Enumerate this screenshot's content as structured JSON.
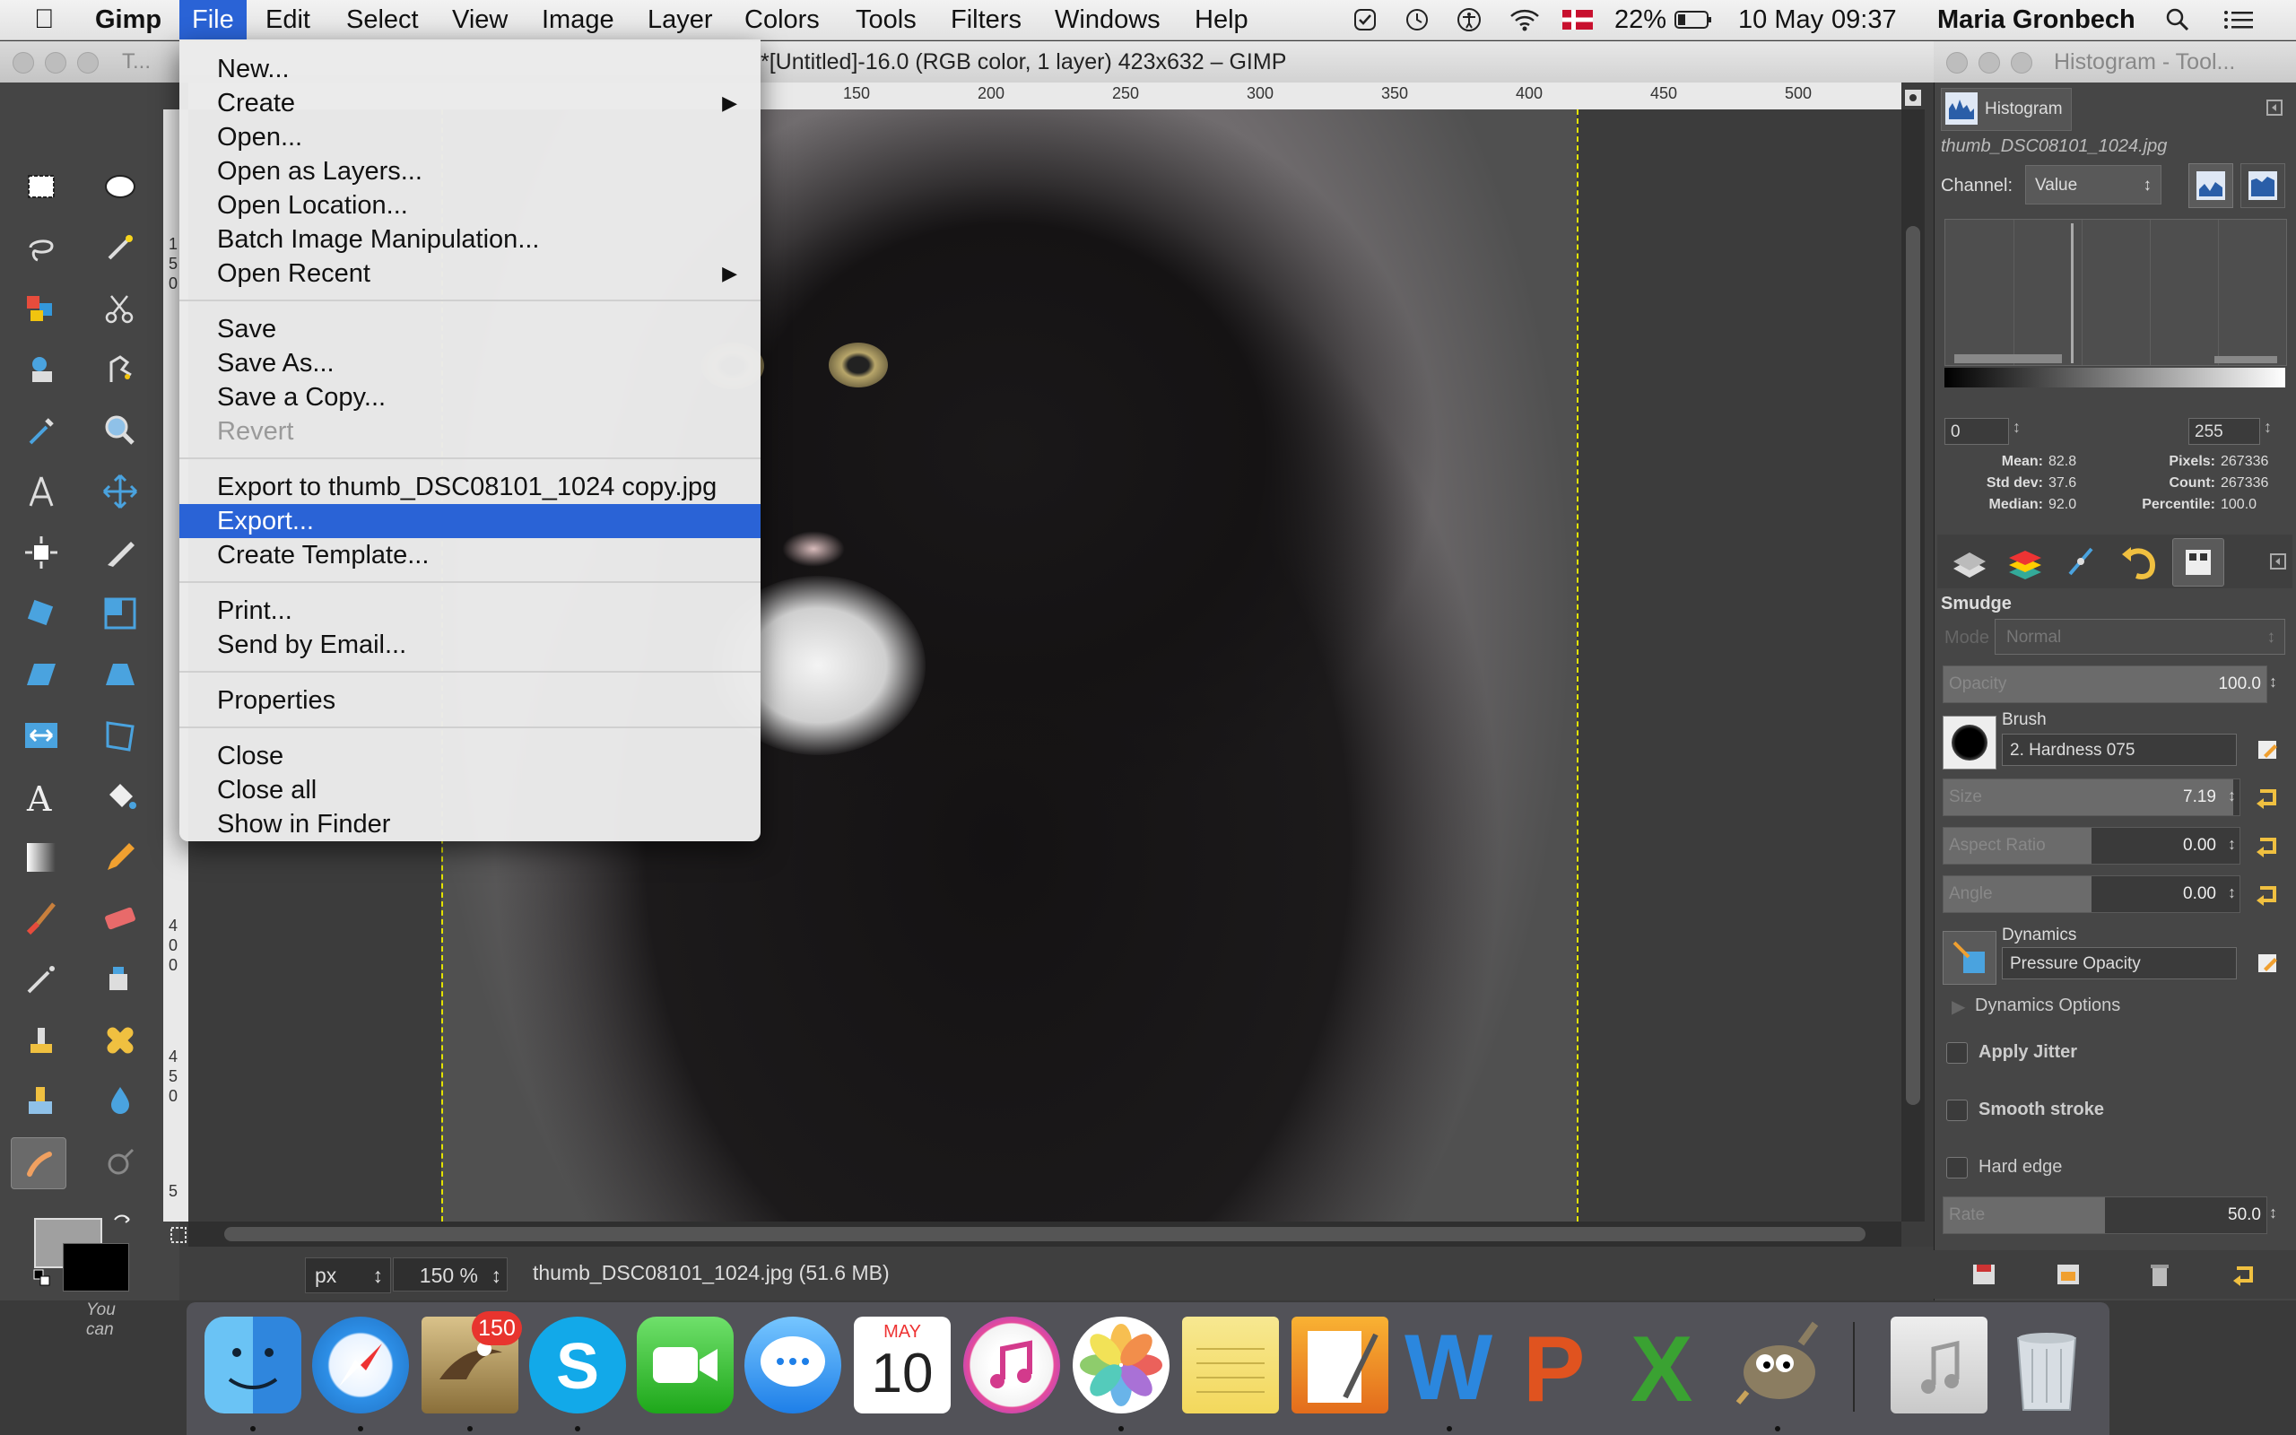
{
  "menubar": {
    "app": "Gimp",
    "items": [
      "File",
      "Edit",
      "Select",
      "View",
      "Image",
      "Layer",
      "Colors",
      "Tools",
      "Filters",
      "Windows",
      "Help"
    ],
    "active": "File",
    "battery": "22%",
    "date": "10 May",
    "time": "09:37",
    "user": "Maria Gronbech"
  },
  "toolbox": {
    "title": "T...",
    "hint": [
      "You",
      "can"
    ]
  },
  "image_window": {
    "title": "*[Untitled]-16.0 (RGB color, 1 layer) 423x632 – GIMP",
    "ruler_top": [
      "150",
      "200",
      "250",
      "300",
      "350",
      "400",
      "450",
      "500"
    ],
    "ruler_left": [
      "1",
      "5",
      "0",
      "4",
      "0",
      "0",
      "4",
      "5",
      "0",
      "5"
    ],
    "unit": "px",
    "zoom": "150 %",
    "status": "thumb_DSC08101_1024.jpg (51.6 MB)"
  },
  "file_menu": {
    "groups": [
      [
        {
          "label": "New...",
          "disabled": false,
          "submenu": false
        },
        {
          "label": "Create",
          "disabled": false,
          "submenu": true
        },
        {
          "label": "Open...",
          "disabled": false,
          "submenu": false
        },
        {
          "label": "Open as Layers...",
          "disabled": false,
          "submenu": false
        },
        {
          "label": "Open Location...",
          "disabled": false,
          "submenu": false
        },
        {
          "label": "Batch Image Manipulation...",
          "disabled": false,
          "submenu": false
        },
        {
          "label": "Open Recent",
          "disabled": false,
          "submenu": true
        }
      ],
      [
        {
          "label": "Save",
          "disabled": false,
          "submenu": false
        },
        {
          "label": "Save As...",
          "disabled": false,
          "submenu": false
        },
        {
          "label": "Save a Copy...",
          "disabled": false,
          "submenu": false
        },
        {
          "label": "Revert",
          "disabled": true,
          "submenu": false
        }
      ],
      [
        {
          "label": "Export to thumb_DSC08101_1024 copy.jpg",
          "disabled": false,
          "submenu": false
        },
        {
          "label": "Export...",
          "disabled": false,
          "submenu": false,
          "highlighted": true
        },
        {
          "label": "Create Template...",
          "disabled": false,
          "submenu": false
        }
      ],
      [
        {
          "label": "Print...",
          "disabled": false,
          "submenu": false
        },
        {
          "label": "Send by Email...",
          "disabled": false,
          "submenu": false
        }
      ],
      [
        {
          "label": "Properties",
          "disabled": false,
          "submenu": false
        }
      ],
      [
        {
          "label": "Close",
          "disabled": false,
          "submenu": false
        },
        {
          "label": "Close all",
          "disabled": false,
          "submenu": false
        },
        {
          "label": "Show in Finder",
          "disabled": false,
          "submenu": false
        }
      ]
    ]
  },
  "dock": {
    "title": "Histogram - Tool...",
    "histogram": {
      "tab": "Histogram",
      "file": "thumb_DSC08101_1024.jpg",
      "channel_label": "Channel:",
      "channel": "Value",
      "range_min": "0",
      "range_max": "255",
      "stats": {
        "mean_label": "Mean:",
        "mean": "82.8",
        "std_label": "Std dev:",
        "std": "37.6",
        "median_label": "Median:",
        "median": "92.0",
        "pixels_label": "Pixels:",
        "pixels": "267336",
        "count_label": "Count:",
        "count": "267336",
        "percentile_label": "Percentile:",
        "percentile": "100.0"
      }
    },
    "tool_options": {
      "tool": "Smudge",
      "mode_label": "Mode",
      "mode": "Normal",
      "opacity_label": "Opacity",
      "opacity": "100.0",
      "brush_label": "Brush",
      "brush": "2. Hardness 075",
      "size_label": "Size",
      "size": "7.19",
      "aspect_label": "Aspect Ratio",
      "aspect": "0.00",
      "angle_label": "Angle",
      "angle": "0.00",
      "dynamics_label": "Dynamics",
      "dynamics": "Pressure Opacity",
      "dynamics_options": "Dynamics Options",
      "apply_jitter": "Apply Jitter",
      "smooth_stroke": "Smooth stroke",
      "hard_edge": "Hard edge",
      "rate_label": "Rate",
      "rate": "50.0"
    }
  },
  "dock_apps": {
    "mail_badge": "150",
    "calendar_month": "MAY",
    "calendar_day": "10"
  },
  "colors": {
    "accent": "#2a63d6",
    "guide": "#e3e300"
  }
}
